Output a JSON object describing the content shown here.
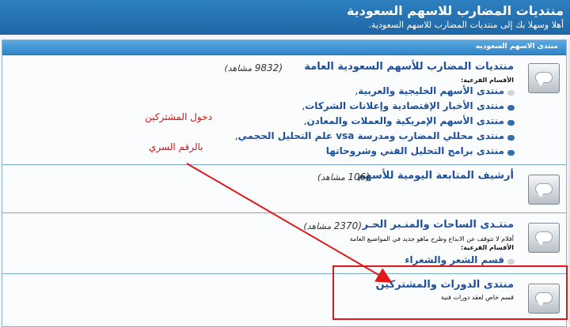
{
  "header": {
    "title": "منتديات المضارب للاسهم السعودية",
    "subtitle": "أهلا وسهلا بك إلى منتديات المضارب للاسهم السعودية."
  },
  "category": {
    "title": "منتدى الاسهم السعوديه"
  },
  "forums": [
    {
      "title": "منتديات المضارب للأسهم السعودية العامة",
      "views_count": "(9832",
      "views_label": "مشاهد)",
      "subforums_label": "الأقسام الفرعية:",
      "subforums": [
        "منتدى الأسهم الخليجية والعربية",
        "منتدى الأخبار الإقتصادية وإعلانات الشركات",
        "منتدى الأسهم الإمريكية والعملات والمعادن",
        "منتدى محللي المضارب ومدرسة vsa علم التحليل الحجمي",
        "منتدى برامج التحليل الفني وشروحاتها"
      ]
    },
    {
      "title": "أرشيف المتابعة اليومية للأسهم",
      "views_count": "(106",
      "views_label": "مشاهد)"
    },
    {
      "title": "منتـدى الساحات والمنـبر الحـر",
      "views_count": "(2370",
      "views_label": "مشاهد)",
      "description": "أقلام لا تتوقف عن الابداع وطرح ماهو جديد في المواضيع العامة",
      "subforums_label": "الأقسام الفرعية:",
      "subforums": [
        "قسم الشعر والشعراء"
      ]
    },
    {
      "title": "منتدى الدورات والمشتركين",
      "description": "قسم خاص لعقد دورات فنية"
    }
  ],
  "annotation": {
    "line1": "دخول المشتركين",
    "line2": "بالرقم السري"
  },
  "colors": {
    "header": "#2474b5",
    "category_bar": "#3b91d4",
    "forum_link": "#1e4f9b",
    "annotation": "#dd1111"
  }
}
